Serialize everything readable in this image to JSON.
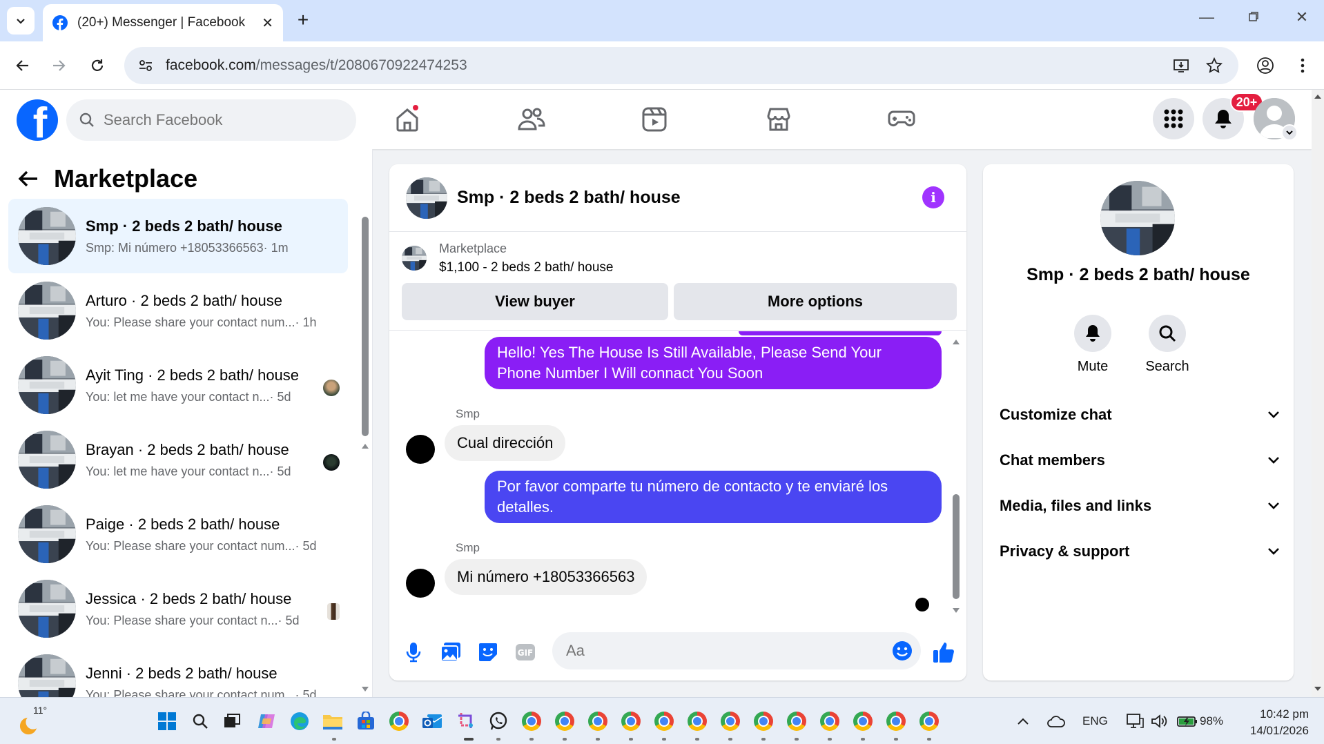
{
  "browser": {
    "tab_title": "(20+) Messenger | Facebook",
    "url_host": "facebook.com",
    "url_path": "/messages/t/2080670922474253"
  },
  "header": {
    "search_placeholder": "Search Facebook",
    "notifications_badge": "20+"
  },
  "sidebar": {
    "title": "Marketplace",
    "conversations": [
      {
        "name": "Smp · 2 beds 2 bath/ house",
        "preview": "Smp: Mi número +18053366563",
        "time": " · 1m",
        "active": true
      },
      {
        "name": "Arturo · 2 beds 2 bath/ house",
        "preview": "You: Please share your contact num...",
        "time": " · 1h"
      },
      {
        "name": "Ayit Ting · 2 beds 2 bath/ house",
        "preview": "You: let me have your contact n...",
        "time": " · 5d"
      },
      {
        "name": "Brayan · 2 beds 2 bath/ house",
        "preview": "You: let me have your contact n...",
        "time": " · 5d"
      },
      {
        "name": "Paige · 2 beds 2 bath/ house",
        "preview": "You: Please share your contact num...",
        "time": " · 5d"
      },
      {
        "name": "Jessica · 2 beds 2 bath/ house",
        "preview": "You: Please share your contact n...",
        "time": " · 5d"
      },
      {
        "name": "Jenni · 2 beds 2 bath/ house",
        "preview": "You: Please share your contact num...",
        "time": " · 5d"
      }
    ]
  },
  "chat": {
    "title": "Smp · 2 beds 2 bath/ house",
    "marketplace_label": "Marketplace",
    "listing": "$1,100 - 2 beds 2 bath/ house",
    "view_buyer": "View buyer",
    "more_options": "More options",
    "messages": [
      {
        "from": "me",
        "text": "Hello! Yes The House  Is Still Available, Please Send Your Phone Number I Will connact You Soon"
      },
      {
        "from": "them",
        "sender": "Smp",
        "text": "Cual dirección"
      },
      {
        "from": "me",
        "text": "Por favor comparte tu número de contacto y te enviaré los detalles."
      },
      {
        "from": "them",
        "sender": "Smp",
        "text": "Mi número +18053366563"
      }
    ],
    "composer_placeholder": "Aa"
  },
  "info_panel": {
    "name": "Smp · 2 beds 2 bath/ house",
    "mute_label": "Mute",
    "search_label": "Search",
    "sections": [
      "Customize chat",
      "Chat members",
      "Media, files and links",
      "Privacy & support"
    ]
  },
  "taskbar": {
    "weather_temp": "11°",
    "language": "ENG",
    "battery": "98%",
    "time": "10:42 pm",
    "date": "14/01/2026"
  },
  "colors": {
    "fb_blue": "#0866ff",
    "bubble_purple": "#8a1ef5",
    "bubble_blue": "#4a46f2",
    "info_purple": "#a033ff"
  }
}
